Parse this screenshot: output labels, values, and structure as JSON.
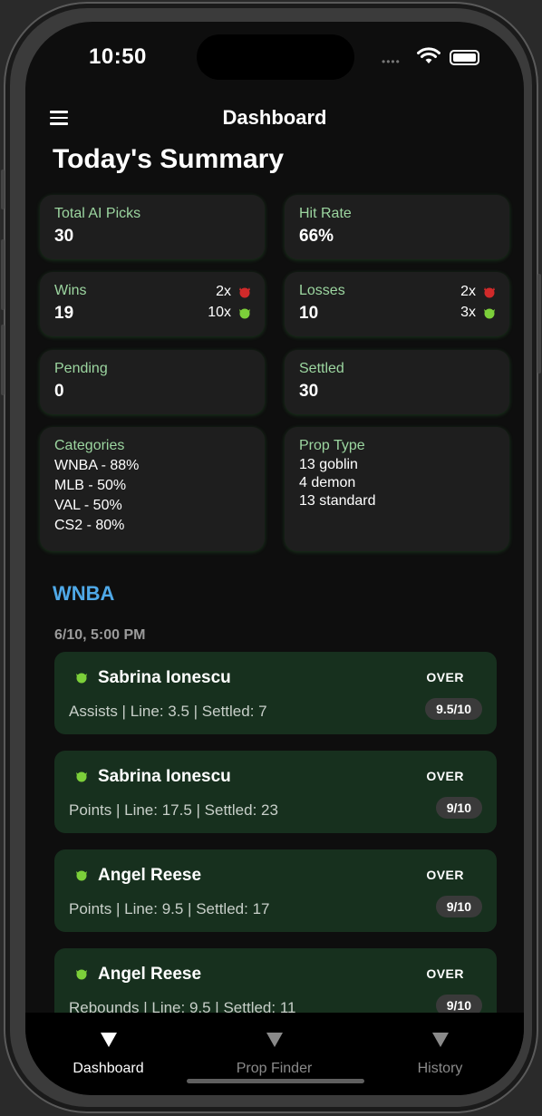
{
  "status_bar": {
    "time": "10:50",
    "signal_dots": "••••"
  },
  "header": {
    "title": "Dashboard"
  },
  "summary": {
    "title": "Today's Summary",
    "total_ai_picks": {
      "label": "Total AI Picks",
      "value": "30"
    },
    "hit_rate": {
      "label": "Hit Rate",
      "value": "66%"
    },
    "wins": {
      "label": "Wins",
      "value": "19",
      "demon_count": "2x",
      "goblin_count": "10x"
    },
    "losses": {
      "label": "Losses",
      "value": "10",
      "demon_count": "2x",
      "goblin_count": "3x"
    },
    "pending": {
      "label": "Pending",
      "value": "0"
    },
    "settled": {
      "label": "Settled",
      "value": "30"
    },
    "categories": {
      "label": "Categories",
      "items": [
        "WNBA - 88%",
        "MLB - 50%",
        "VAL - 50%",
        "CS2 - 80%"
      ]
    },
    "prop_type": {
      "label": "Prop Type",
      "items": [
        "13 goblin",
        "4 demon",
        "13 standard"
      ]
    }
  },
  "section": {
    "title": "WNBA",
    "date": "6/10, 5:00 PM"
  },
  "picks": [
    {
      "player": "Sabrina Ionescu",
      "direction": "OVER",
      "details": "Assists | Line: 3.5 | Settled: 7",
      "score": "9.5/10"
    },
    {
      "player": "Sabrina Ionescu",
      "direction": "OVER",
      "details": "Points | Line: 17.5 | Settled: 23",
      "score": "9/10"
    },
    {
      "player": "Angel Reese",
      "direction": "OVER",
      "details": "Points | Line: 9.5 | Settled: 17",
      "score": "9/10"
    },
    {
      "player": "Angel Reese",
      "direction": "OVER",
      "details": "Rebounds | Line: 9.5 | Settled: 11",
      "score": "9/10"
    }
  ],
  "tabs": [
    {
      "label": "Dashboard",
      "active": true
    },
    {
      "label": "Prop Finder",
      "active": false
    },
    {
      "label": "History",
      "active": false
    }
  ],
  "colors": {
    "accent_green": "#9cd6a0",
    "section_blue": "#4fa9e8",
    "pick_bg": "#17301e",
    "goblin": "#7ccf3a",
    "demon": "#d02a2a"
  }
}
